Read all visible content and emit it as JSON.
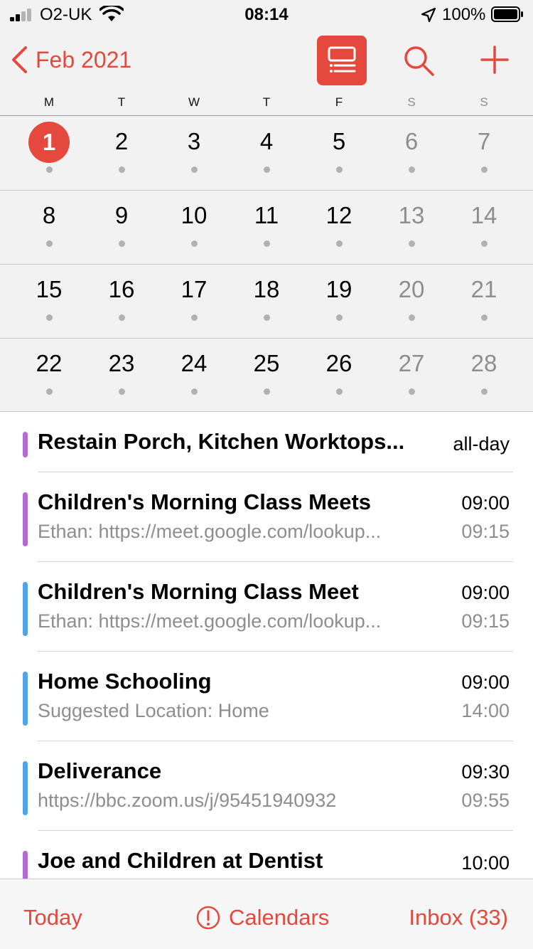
{
  "status_bar": {
    "carrier": "O2-UK",
    "time": "08:14",
    "battery_percent": "100%",
    "battery_level": 1.0,
    "signal_bars": 2
  },
  "nav": {
    "back_label": "Feb 2021",
    "accent_color": "#e5483c"
  },
  "weekdays": [
    "M",
    "T",
    "W",
    "T",
    "F",
    "S",
    "S"
  ],
  "weeks": [
    [
      "1",
      "2",
      "3",
      "4",
      "5",
      "6",
      "7"
    ],
    [
      "8",
      "9",
      "10",
      "11",
      "12",
      "13",
      "14"
    ],
    [
      "15",
      "16",
      "17",
      "18",
      "19",
      "20",
      "21"
    ],
    [
      "22",
      "23",
      "24",
      "25",
      "26",
      "27",
      "28"
    ]
  ],
  "today": "1",
  "events": [
    {
      "title": "Restain Porch, Kitchen Worktops...",
      "subtitle": "",
      "start": "all-day",
      "end": "",
      "color": "#b26ad4"
    },
    {
      "title": "Children's Morning Class Meets",
      "subtitle": "Ethan: https://meet.google.com/lookup...",
      "start": "09:00",
      "end": "09:15",
      "color": "#b26ad4"
    },
    {
      "title": "Children's Morning Class Meet",
      "subtitle": "Ethan: https://meet.google.com/lookup...",
      "start": "09:00",
      "end": "09:15",
      "color": "#4fa3e6"
    },
    {
      "title": "Home Schooling",
      "subtitle": "Suggested Location: Home",
      "start": "09:00",
      "end": "14:00",
      "color": "#4fa3e6"
    },
    {
      "title": "Deliverance",
      "subtitle": "https://bbc.zoom.us/j/95451940932",
      "start": "09:30",
      "end": "09:55",
      "color": "#4fa3e6"
    },
    {
      "title": "Joe and Children at Dentist",
      "subtitle": "",
      "start": "10:00",
      "end": "",
      "color": "#b26ad4"
    }
  ],
  "toolbar": {
    "today_label": "Today",
    "calendars_label": "Calendars",
    "inbox_label": "Inbox (33)"
  }
}
